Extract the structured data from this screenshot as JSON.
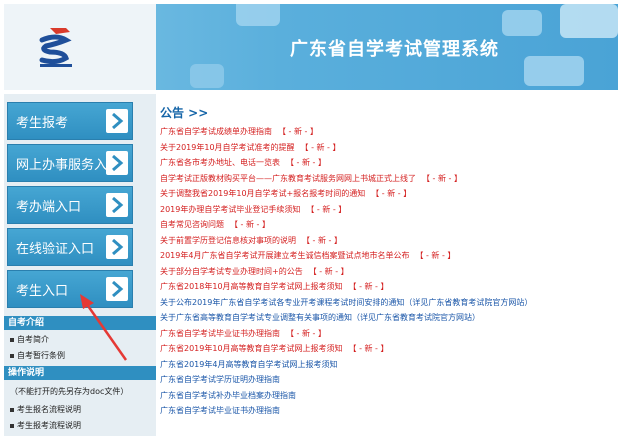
{
  "header": {
    "title": "广东省自学考试管理系统"
  },
  "sidebar": {
    "nav": [
      {
        "label": "考生报考"
      },
      {
        "label": "网上办事服务入口"
      },
      {
        "label": "考办端入口"
      },
      {
        "label": "在线验证入口"
      },
      {
        "label": "考生入口"
      }
    ],
    "intro_title": "自考介绍",
    "intro_links": [
      "自考简介",
      "自考暂行条例"
    ],
    "guide_title": "操作说明",
    "guide_note": "（不能打开的先另存为doc文件）",
    "guide_links": [
      "考生报名流程说明",
      "考生报考流程说明"
    ]
  },
  "notice": {
    "title": "公告 >>",
    "new_label": "【 - 新 - 】",
    "items": [
      {
        "text": "广东省自学考试成绩单办理指南",
        "color": "red",
        "new": true
      },
      {
        "text": "关于2019年10月自学考试准考的提醒",
        "color": "red",
        "new": true
      },
      {
        "text": "广东省各市考办地址、电话一览表",
        "color": "red",
        "new": true
      },
      {
        "text": "自学考试正版教材购买平台——广东教育考试服务网网上书城正式上线了",
        "color": "red",
        "new": true
      },
      {
        "text": "关于调整我省2019年10月自学考试+报名报考时间的通知",
        "color": "red",
        "new": true
      },
      {
        "text": "2019年办理自学考试毕业登记手续须知",
        "color": "red",
        "new": true
      },
      {
        "text": "自考常见咨询问题",
        "color": "red",
        "new": true
      },
      {
        "text": "关于前置学历登记信息核对事项的说明",
        "color": "red",
        "new": true
      },
      {
        "text": "2019年4月广东省自学考试开展建立考生诚信档案暨试点地市名单公布",
        "color": "red",
        "new": true
      },
      {
        "text": "关于部分自学考试专业办理时间+的公告",
        "color": "red",
        "new": true
      },
      {
        "text": "广东省2018年10月高等教育自学考试网上报考须知",
        "color": "red",
        "new": true
      },
      {
        "text": "关于公布2019年广东省自学考试各专业开考课程考试时间安排的通知（详见广东省教育考试院官方网站）",
        "color": "blue",
        "new": false
      },
      {
        "text": "关于广东省高等教育自学考试专业调整有关事项的通知（详见广东省教育考试院官方网站）",
        "color": "blue",
        "new": false
      },
      {
        "text": "广东省自学考试毕业证书办理指南",
        "color": "red",
        "new": true
      },
      {
        "text": "广东省2019年10月高等教育自学考试网上报考须知",
        "color": "red",
        "new": true
      },
      {
        "text": "广东省2019年4月高等教育自学考试网上报考须知",
        "color": "blue",
        "new": false
      },
      {
        "text": "广东省自学考试学历证明办理指南",
        "color": "blue",
        "new": false
      },
      {
        "text": "广东省自学考试补办毕业档案办理指南",
        "color": "blue",
        "new": false
      },
      {
        "text": "广东省自学考试毕业证书办理指南",
        "color": "blue",
        "new": false
      }
    ]
  },
  "colors": {
    "header_blue": "#5aafdc",
    "nav_blue": "#2f8fc1",
    "notice_red": "#d42020",
    "notice_blue": "#1a56a8",
    "annotation_red": "#e53935"
  }
}
